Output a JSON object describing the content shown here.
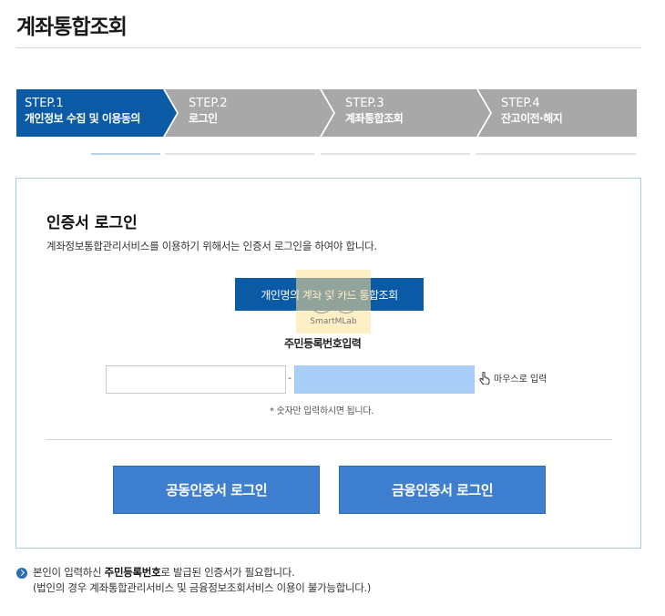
{
  "page": {
    "title": "계좌통합조회"
  },
  "steps": [
    {
      "num": "STEP.1",
      "label": "개인정보 수집 및 이용동의",
      "active": true
    },
    {
      "num": "STEP.2",
      "label": "로그인",
      "active": false
    },
    {
      "num": "STEP.3",
      "label": "계좌통합조회",
      "active": false
    },
    {
      "num": "STEP.4",
      "label": "잔고이전·해지",
      "active": false
    }
  ],
  "colors": {
    "active_step": "#0a5aa5",
    "inactive_step": "#a8a8a8",
    "button": "#3f7fcf",
    "panel_border": "#a9cde0"
  },
  "login_panel": {
    "title": "인증서 로그인",
    "description": "계좌정보통합관리서비스를 이용하기 위해서는 인증서 로그인을 하여야 합니다.",
    "inquiry_button": "개인명의 계좌 및 카드 통합조회",
    "watermark": "SmartMLab",
    "rrn_label": "주민등록번호입력",
    "rrn_front_value": "",
    "rrn_separator": "-",
    "rrn_back_value": "",
    "mouse_input_label": "마우스로 입력",
    "mouse_icon": "hand-pointer-icon",
    "digits_note": "* 숫자만 입력하시면 됩니다.",
    "common_cert_button": "공동인증서 로그인",
    "finance_cert_button": "금융인증서 로그인"
  },
  "notice": {
    "icon": "chevron-right-circle-icon",
    "line1_prefix": "본인이 입력하신 ",
    "line1_bold": "주민등록번호",
    "line1_suffix": "로 발급된 인증서가 필요합니다.",
    "line2": "(법인의 경우 계좌통합관리서비스 및 금융정보조회서비스 이용이 불가능합니다.)"
  }
}
